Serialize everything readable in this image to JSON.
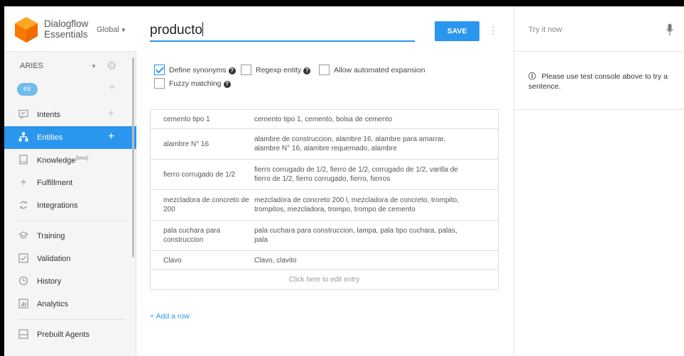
{
  "brand": {
    "name_line1": "Dialogflow",
    "name_line2": "Essentials",
    "region": "Global"
  },
  "agent": {
    "name": "ARIES",
    "language": "es"
  },
  "nav": [
    {
      "label": "Intents",
      "icon": "chat-icon",
      "plus": "+"
    },
    {
      "label": "Entities",
      "icon": "sitemap-icon",
      "plus": "+"
    },
    {
      "label": "Knowledge",
      "badge": "[beta]",
      "icon": "book-icon"
    },
    {
      "label": "Fulfillment",
      "icon": "bolt-icon"
    },
    {
      "label": "Integrations",
      "icon": "loop-icon"
    },
    {
      "label": "Training",
      "icon": "graduation-cap-icon"
    },
    {
      "label": "Validation",
      "icon": "check-square-icon"
    },
    {
      "label": "History",
      "icon": "clock-icon"
    },
    {
      "label": "Analytics",
      "icon": "bar-chart-icon"
    },
    {
      "label": "Prebuilt Agents",
      "icon": "box-icon"
    }
  ],
  "header": {
    "entity_name": "producto",
    "save_label": "SAVE"
  },
  "options": {
    "define_synonyms": {
      "label": "Define synonyms",
      "checked": true
    },
    "regexp": {
      "label": "Regexp entity",
      "checked": false
    },
    "auto_expansion": {
      "label": "Allow automated expansion",
      "checked": false
    },
    "fuzzy": {
      "label": "Fuzzy matching",
      "checked": false
    }
  },
  "entries": [
    {
      "value": "cemento tipo 1",
      "synonyms": "cemento tipo 1, cemento, bolsa de cemento"
    },
    {
      "value": "alambre N° 16",
      "synonyms": "alambre de construccion, alambre 16, alambre para amarrar, alambre N° 16, alambre requemado, alambre"
    },
    {
      "value": "fierro corrugado de 1/2",
      "synonyms": "fierro corrugado de 1/2, fierro de 1/2, corrugado de 1/2, varilla de fierro de 1/2, fierro corrugado, fierro, fierros"
    },
    {
      "value": "mezcladora de concreto de 200",
      "synonyms": "mezcladora de concreto 200 l, mezcladora de concreto, trompito, trompitos, mezcladora, trompo, trompo de cemento"
    },
    {
      "value": "pala cuchara para construccion",
      "synonyms": "pala cuchara para construccion, lampa, pala tipo cuchara, palas, pala"
    },
    {
      "value": "Clavo",
      "synonyms": "Clavo, clavito"
    }
  ],
  "edit_entry_label": "Click here to edit entry",
  "add_row_label": "+ Add a row",
  "try_panel": {
    "placeholder": "Try it now",
    "message": "Please use test console above to try a sentence.",
    "info_glyph": "ⓘ"
  },
  "colors": {
    "accent": "#2b96ed",
    "logo": "#f57c00",
    "chip": "#6fbcec"
  }
}
